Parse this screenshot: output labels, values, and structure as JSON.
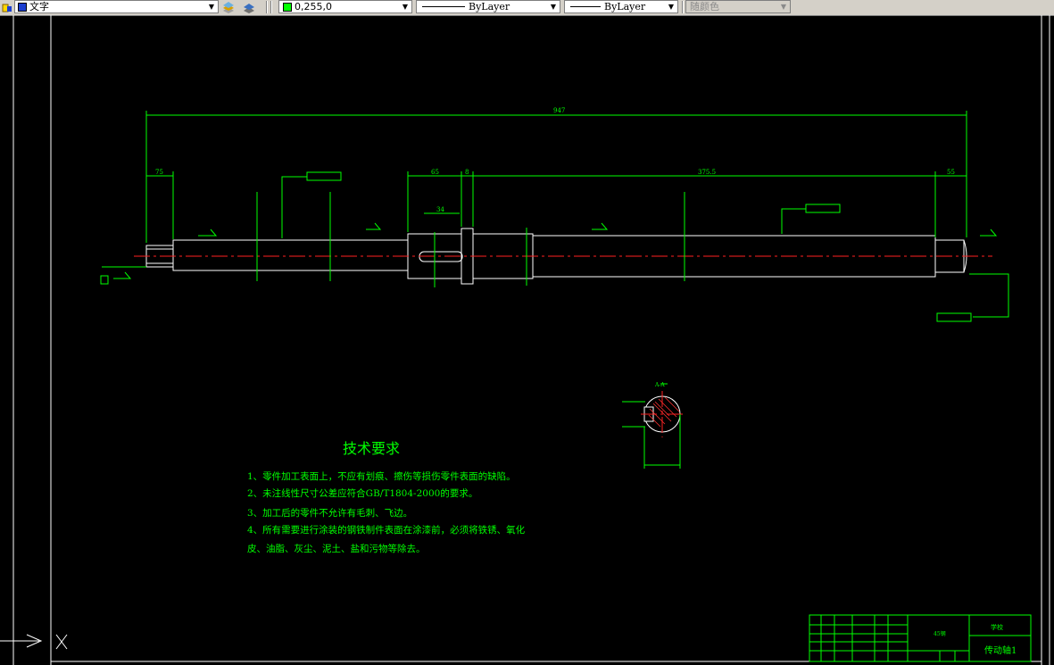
{
  "toolbar": {
    "text_style": "文字",
    "color_value": "0,255,0",
    "linetype": "ByLayer",
    "lineweight": "ByLayer",
    "plot_style": "随颜色"
  },
  "colors": {
    "background": "#000000",
    "geometry": "#ffffff",
    "annotation": "#00ff00",
    "centerline": "#ff0000",
    "swatch": "#00ff00"
  },
  "drawing": {
    "dimensions": {
      "overall_length": "947",
      "left_step": "75",
      "key_offset": "65",
      "collar": "8",
      "main_length": "375.5",
      "right_step": "55",
      "keyway_length": "34"
    },
    "section_label": "A-A",
    "technical_requirements": {
      "title": "技术要求",
      "items": [
        "1、零件加工表面上，不应有划痕、擦伤等损伤零件表面的缺陷。",
        "2、未注线性尺寸公差应符合GB/T1804-2000的要求。",
        "3、加工后的零件不允许有毛刺、飞边。",
        "4、所有需要进行涂装的钢铁制件表面在涂漆前，必须将铁锈、氧化",
        "皮、油脂、灰尘、泥土、盐和污物等除去。"
      ]
    },
    "title_block": {
      "material": "45钢",
      "school": "学校",
      "part_name": "传动轴1"
    }
  },
  "icons": [
    "layer-manager-icon",
    "layer-states-icon",
    "ucs-icon"
  ]
}
